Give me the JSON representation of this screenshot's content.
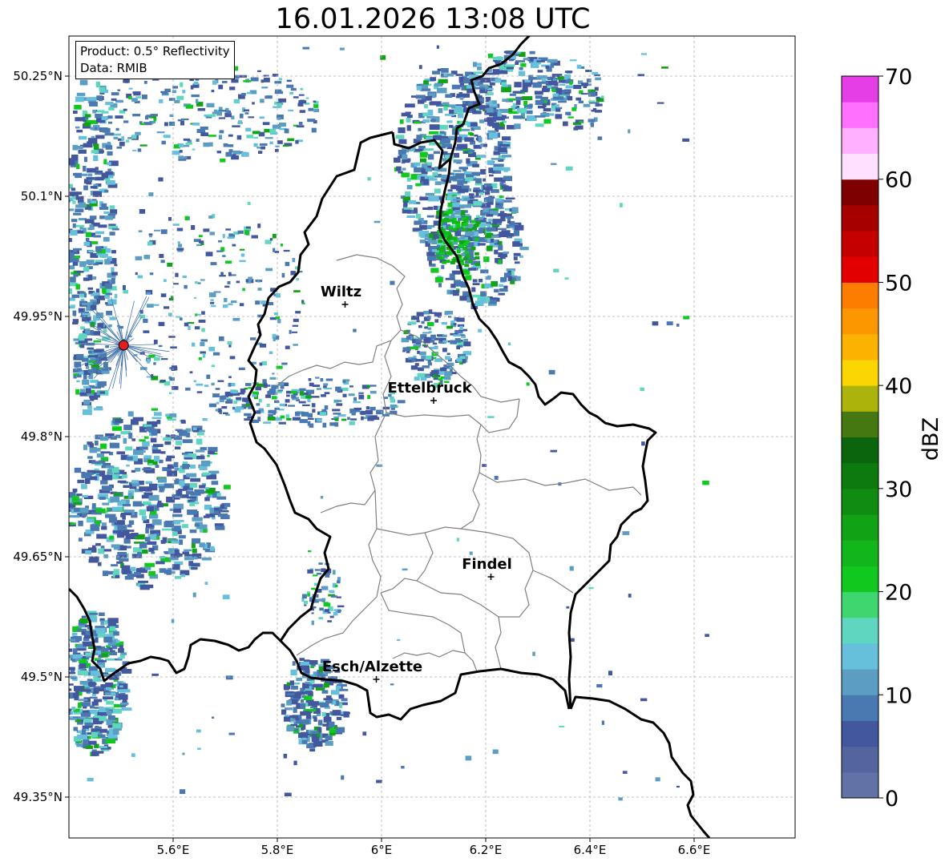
{
  "title": "16.01.2026 13:08 UTC",
  "info_box": {
    "product": "Product: 0.5° Reflectivity",
    "data": "Data: RMIB"
  },
  "map": {
    "lon_range": [
      5.4,
      6.8
    ],
    "lat_range": [
      49.3,
      50.3
    ],
    "lon_ticks": [
      {
        "value": 5.6,
        "label": "5.6°E"
      },
      {
        "value": 5.8,
        "label": "5.8°E"
      },
      {
        "value": 6.0,
        "label": "6°E"
      },
      {
        "value": 6.2,
        "label": "6.2°E"
      },
      {
        "value": 6.4,
        "label": "6.4°E"
      },
      {
        "value": 6.6,
        "label": "6.6°E"
      }
    ],
    "lat_ticks": [
      {
        "value": 50.25,
        "label": "50.25°N"
      },
      {
        "value": 50.1,
        "label": "50.1°N"
      },
      {
        "value": 49.95,
        "label": "49.95°N"
      },
      {
        "value": 49.8,
        "label": "49.8°N"
      },
      {
        "value": 49.65,
        "label": "49.65°N"
      },
      {
        "value": 49.5,
        "label": "49.5°N"
      },
      {
        "value": 49.35,
        "label": "49.35°N"
      }
    ],
    "grid": true,
    "cities": [
      {
        "name": "Wiltz",
        "lon": 5.93,
        "lat": 49.965
      },
      {
        "name": "Ettelbruck",
        "lon": 6.1,
        "lat": 49.845
      },
      {
        "name": "Findel",
        "lon": 6.21,
        "lat": 49.625
      },
      {
        "name": "Esch/Alzette",
        "lon": 5.99,
        "lat": 49.497
      }
    ],
    "radar_site": {
      "lon": 5.505,
      "lat": 49.914,
      "color": "#e02020"
    }
  },
  "colorbar": {
    "label": "dBZ",
    "min": 0,
    "max": 70,
    "ticks": [
      0,
      10,
      20,
      30,
      40,
      50,
      60,
      70
    ],
    "colors": [
      "#6272a6",
      "#53649f",
      "#43579f",
      "#4a78b0",
      "#5b9dc3",
      "#66c0dc",
      "#5ed6c0",
      "#3ed66e",
      "#10c81e",
      "#12b51a",
      "#12a216",
      "#108c12",
      "#0d7a0f",
      "#0a650c",
      "#467812",
      "#acb30a",
      "#fcd600",
      "#fcb200",
      "#fc9700",
      "#fc7d00",
      "#e20000",
      "#c50000",
      "#a60000",
      "#7f0000",
      "#ffe0ff",
      "#ffb0ff",
      "#ff70ff",
      "#e63ee6"
    ]
  }
}
